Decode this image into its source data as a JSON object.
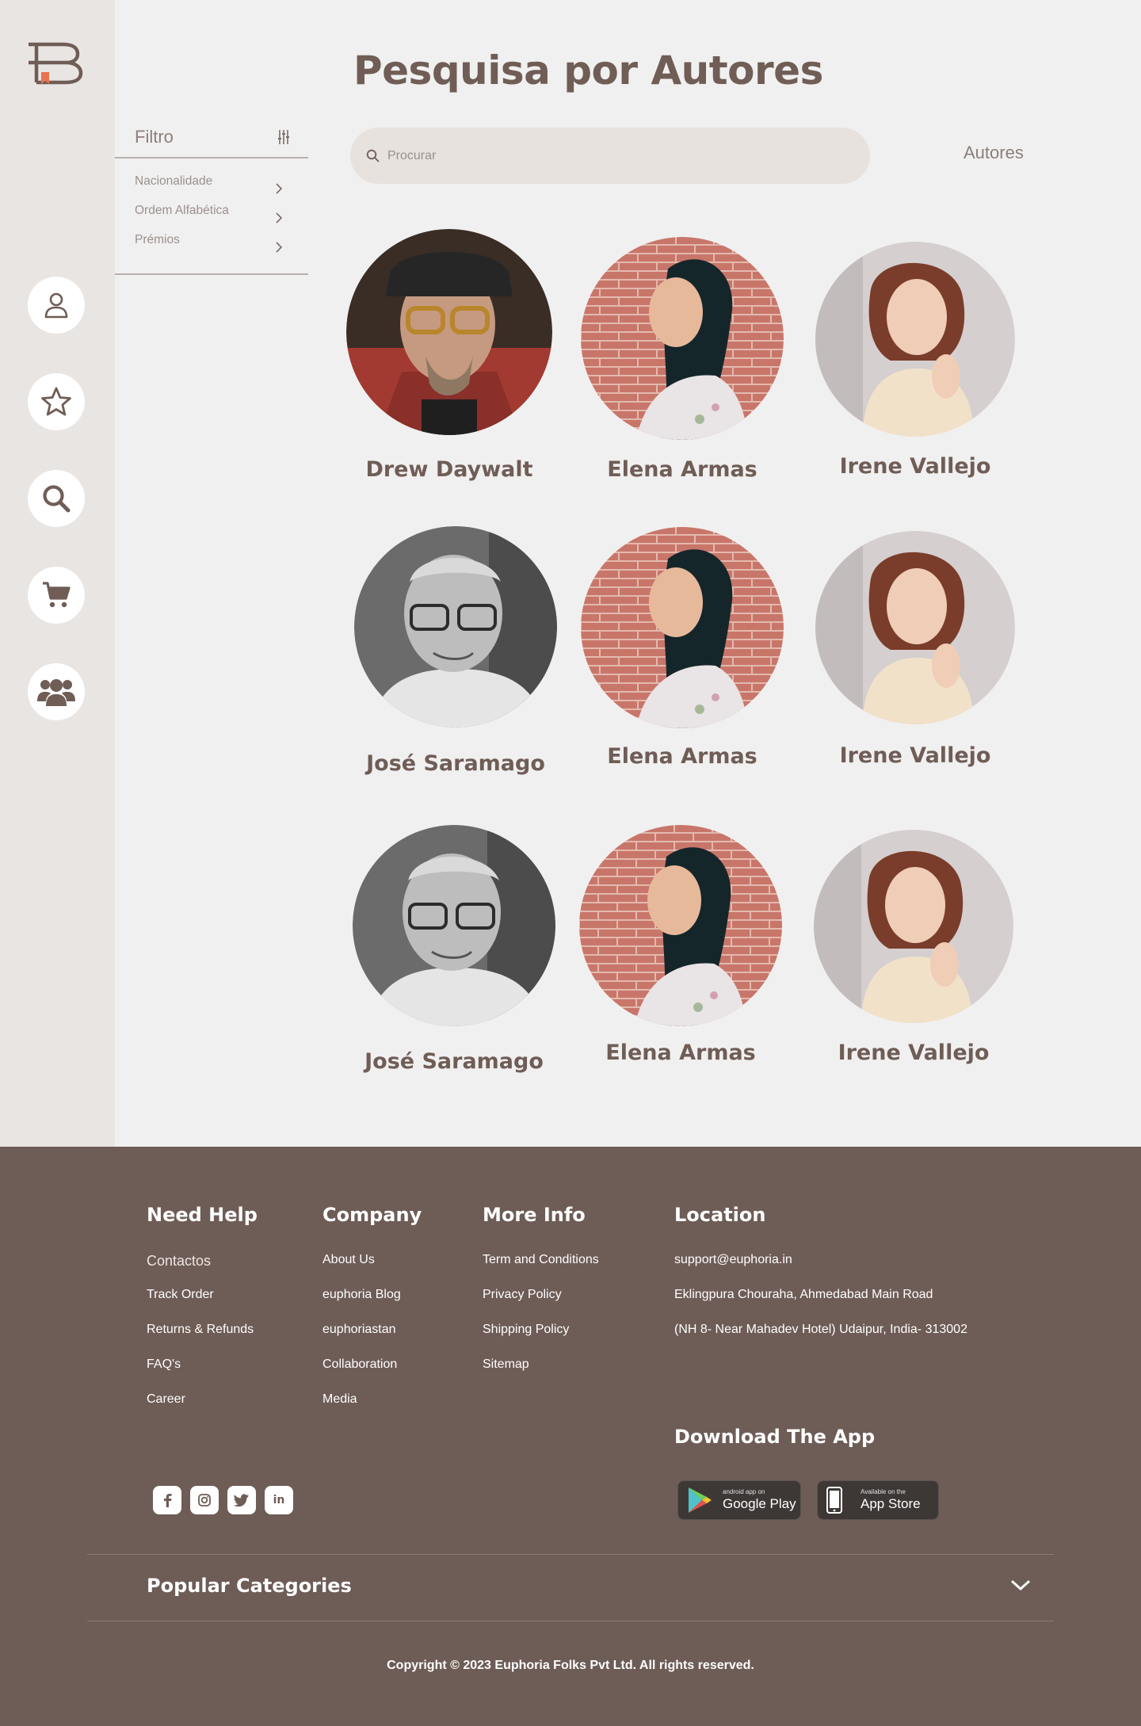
{
  "page": {
    "title": "Pesquisa por Autores"
  },
  "sidebar": {
    "logo": "logo",
    "nav": [
      {
        "icon": "user-icon"
      },
      {
        "icon": "star-icon"
      },
      {
        "icon": "search-icon"
      },
      {
        "icon": "cart-icon"
      },
      {
        "icon": "users-icon"
      }
    ]
  },
  "filter": {
    "title": "Filtro",
    "icon": "sliders-icon",
    "items": [
      {
        "label": "Nacionalidade"
      },
      {
        "label": "Ordem Alfabética"
      },
      {
        "label": "Prémios"
      }
    ]
  },
  "search": {
    "placeholder": "Procurar",
    "value": ""
  },
  "category_label": "Autores",
  "authors": [
    {
      "name": "Drew Daywalt"
    },
    {
      "name": "Elena Armas"
    },
    {
      "name": "Irene Vallejo"
    },
    {
      "name": "José Saramago"
    },
    {
      "name": "Elena Armas"
    },
    {
      "name": "Irene Vallejo"
    },
    {
      "name": "José Saramago"
    },
    {
      "name": "Elena Armas"
    },
    {
      "name": "Irene Vallejo"
    }
  ],
  "footer": {
    "need_help": {
      "title": "Need Help",
      "links": [
        "Contactos",
        "Track Order",
        "Returns & Refunds",
        "FAQ's",
        "Career"
      ]
    },
    "company": {
      "title": "Company",
      "links": [
        "About Us",
        "euphoria Blog",
        "euphoriastan",
        "Collaboration",
        "Media"
      ]
    },
    "more_info": {
      "title": "More Info",
      "links": [
        "Term and Conditions",
        "Privacy Policy",
        "Shipping Policy",
        "Sitemap"
      ]
    },
    "location": {
      "title": "Location",
      "lines": [
        "support@euphoria.in",
        "Eklingpura Chouraha, Ahmedabad Main Road",
        "(NH 8- Near Mahadev Hotel) Udaipur, India- 313002"
      ]
    },
    "download": {
      "title": "Download The App",
      "google": {
        "small": "android app on",
        "big": "Google Play"
      },
      "apple": {
        "small": "Available on the",
        "big": "App Store"
      }
    },
    "social": [
      {
        "icon": "facebook-icon",
        "glyph": "f"
      },
      {
        "icon": "instagram-icon",
        "glyph": ""
      },
      {
        "icon": "twitter-icon",
        "glyph": ""
      },
      {
        "icon": "linkedin-icon",
        "glyph": "in"
      }
    ],
    "popular_categories": "Popular Categories",
    "copyright": "Copyright © 2023 Euphoria Folks Pvt Ltd. All rights reserved."
  },
  "colors": {
    "brand": "#6e5c56",
    "background": "#f1f0f0",
    "sidebar": "#e9e5e3",
    "accent": "#e8734f"
  }
}
